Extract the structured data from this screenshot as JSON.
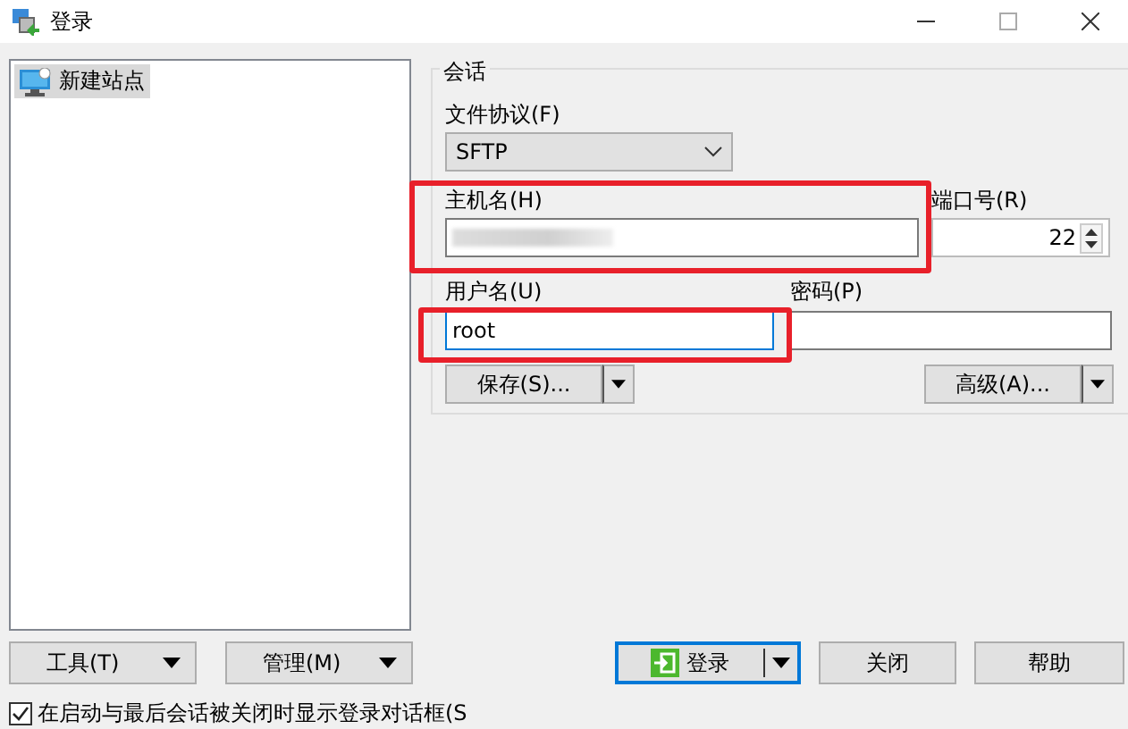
{
  "window": {
    "title": "登录"
  },
  "sites": [
    {
      "label": "新建站点",
      "selected": true
    }
  ],
  "session": {
    "title": "会话",
    "protocol": {
      "label": "文件协议(F)",
      "value": "SFTP"
    },
    "host": {
      "label": "主机名(H)"
    },
    "port": {
      "label": "端口号(R)",
      "value": "22"
    },
    "username": {
      "label": "用户名(U)",
      "value": "root"
    },
    "password": {
      "label": "密码(P)"
    },
    "save_button": "保存(S)...",
    "advanced_button": "高级(A)..."
  },
  "left_buttons": [
    "工具(T)",
    "管理(M)"
  ],
  "login_button": "登录",
  "buttons": [
    "关闭",
    "帮助"
  ],
  "startup_checkbox": {
    "label": "在启动与最后会话被关闭时显示登录对话框(S",
    "checked": true
  }
}
